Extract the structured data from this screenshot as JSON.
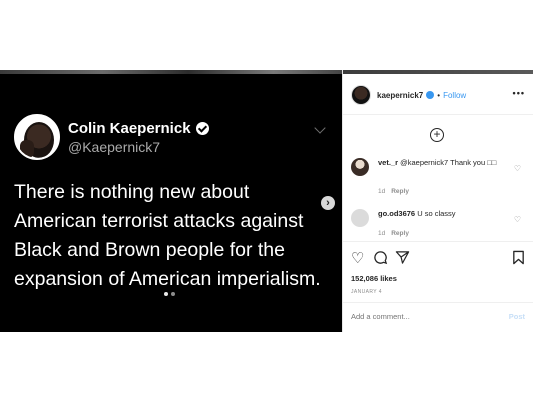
{
  "tweet": {
    "name": "Colin Kaepernick",
    "handle": "@Kaepernick7",
    "text": "There is nothing new about American terrorist attacks against Black and Brown people for the expansion of American imperialism."
  },
  "post_header": {
    "username": "kaepernick7",
    "separator": "•",
    "follow_label": "Follow",
    "more_label": "•••"
  },
  "load_more_label": "+",
  "comments": [
    {
      "username": "vet._r",
      "text": "@kaepernick7 Thank you □□",
      "age": "1d",
      "reply_label": "Reply"
    },
    {
      "username": "go.od3676",
      "text": "U so classy",
      "age": "1d",
      "reply_label": "Reply"
    }
  ],
  "likes": "152,086 likes",
  "date": "JANUARY 4",
  "add_comment_placeholder": "Add a comment...",
  "post_button_label": "Post",
  "icons": {
    "like": "heart-outline-icon",
    "comment": "comment-bubble-icon",
    "share": "paper-plane-icon",
    "save": "bookmark-icon",
    "verified": "verified-badge-icon",
    "next": "chevron-right-icon"
  },
  "colors": {
    "accent": "#3897f0",
    "media_bg": "#000000",
    "post_button": "#c7dff7"
  }
}
